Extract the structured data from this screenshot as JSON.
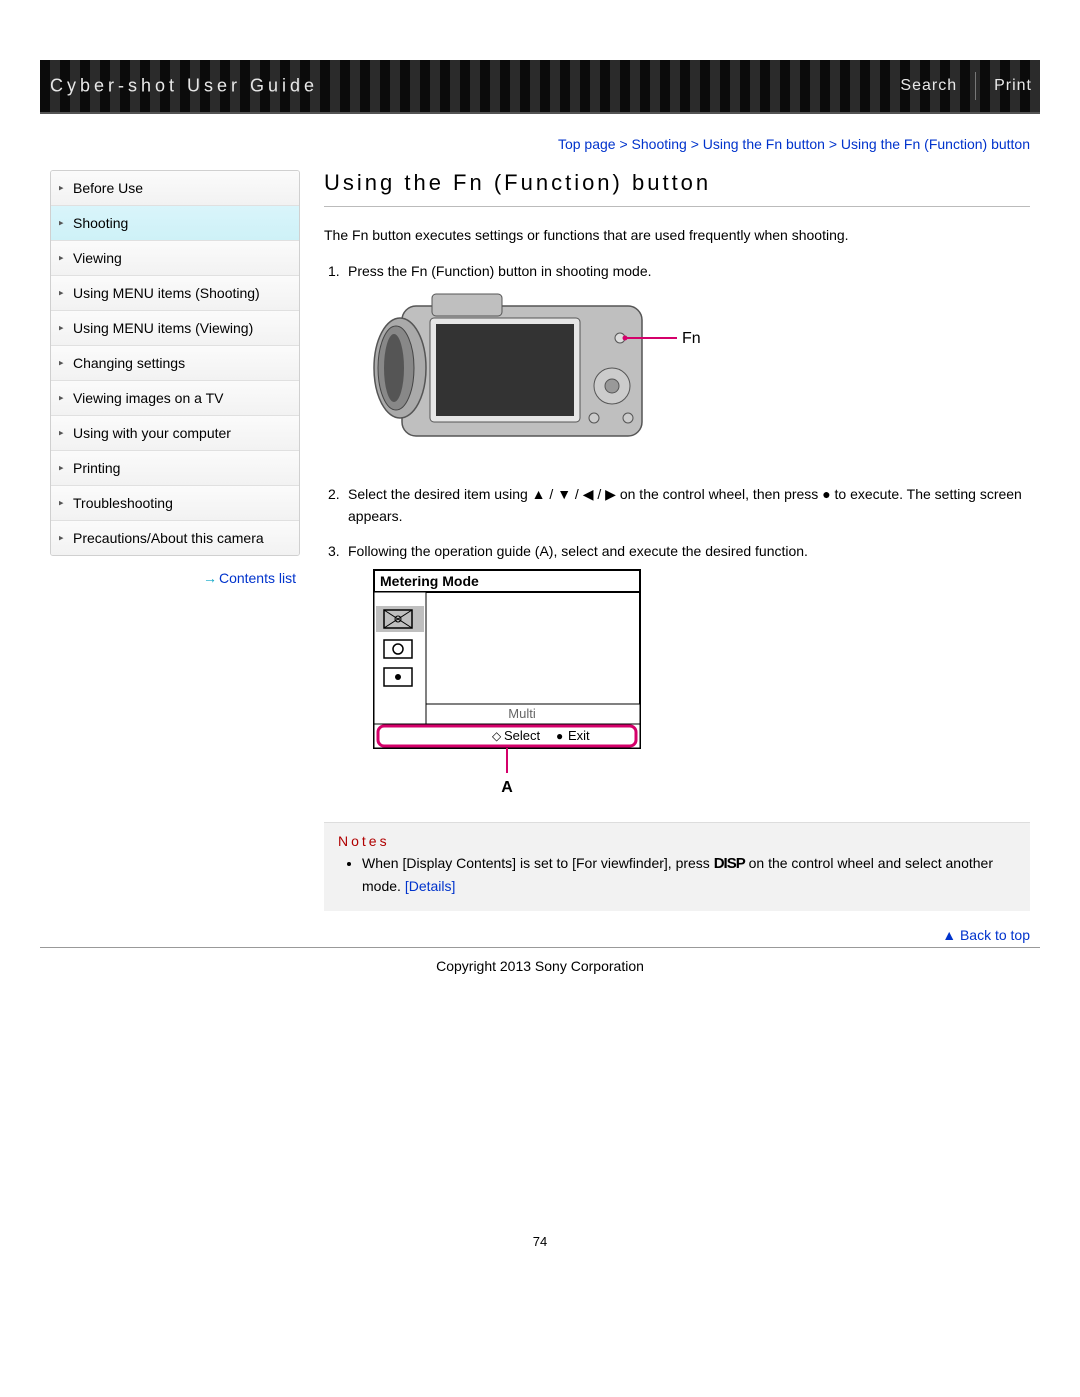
{
  "header": {
    "title": "Cyber-shot User Guide",
    "search": "Search",
    "print": "Print"
  },
  "breadcrumb": "Top page > Shooting > Using the Fn button > Using the Fn (Function) button",
  "sidebar": {
    "items": [
      "Before Use",
      "Shooting",
      "Viewing",
      "Using MENU items (Shooting)",
      "Using MENU items (Viewing)",
      "Changing settings",
      "Viewing images on a TV",
      "Using with your computer",
      "Printing",
      "Troubleshooting",
      "Precautions/About this camera"
    ],
    "active_index": 1,
    "contents_list": "Contents list"
  },
  "main": {
    "title": "Using the Fn (Function) button",
    "intro": "The Fn button executes settings or functions that are used frequently when shooting.",
    "steps": {
      "s1": "Press the Fn (Function) button in shooting mode.",
      "s2_a": "Select the desired item using ",
      "s2_b": " on the control wheel, then press ",
      "s2_c": " to execute. The setting screen appears.",
      "s3": "Following the operation guide (A), select and execute the desired function."
    },
    "camera_label": "Fn",
    "metering": {
      "title": "Metering Mode",
      "option": "Multi",
      "select": "Select",
      "exit": "Exit",
      "guide_label": "A"
    },
    "notes": {
      "title": "Notes",
      "line_a": "When [Display Contents] is set to [For viewfinder], press ",
      "disp": "DISP",
      "line_b": " on the control wheel and select another mode. ",
      "details": "[Details]"
    },
    "back_to_top": "Back to top",
    "copyright": "Copyright 2013 Sony Corporation",
    "page_number": "74"
  }
}
